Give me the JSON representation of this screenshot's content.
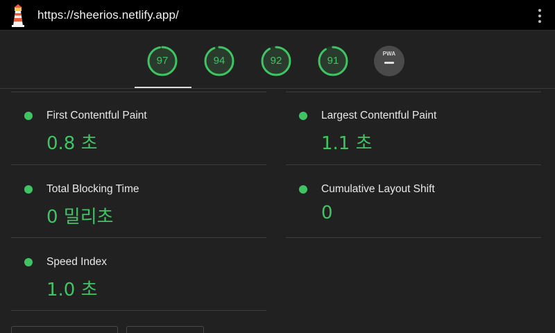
{
  "header": {
    "url": "https://sheerios.netlify.app/",
    "logo_icon": "lighthouse-icon",
    "menu_icon": "more-vert-icon"
  },
  "gauges": [
    {
      "name": "performance",
      "score": "97",
      "value": 0.97
    },
    {
      "name": "accessibility",
      "score": "94",
      "value": 0.94
    },
    {
      "name": "best-practices",
      "score": "92",
      "value": 0.92
    },
    {
      "name": "seo",
      "score": "91",
      "value": 0.91
    }
  ],
  "pwa": {
    "label": "PWA"
  },
  "colors": {
    "pass": "#40c463",
    "bg": "#212121",
    "topbar": "#000000"
  },
  "metrics": [
    {
      "title": "First Contentful Paint",
      "value": "0.8 초"
    },
    {
      "title": "Largest Contentful Paint",
      "value": "1.1 초"
    },
    {
      "title": "Total Blocking Time",
      "value": "0 밀리초"
    },
    {
      "title": "Cumulative Layout Shift",
      "value": "0"
    },
    {
      "title": "Speed Index",
      "value": "1.0 초"
    }
  ]
}
